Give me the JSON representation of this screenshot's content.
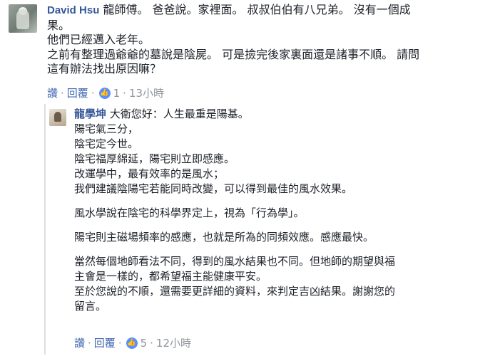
{
  "main_comment": {
    "author": "David Hsu",
    "lines": [
      "龍師傅。 爸爸說。家裡面。 叔叔伯伯有八兄弟。 沒有一個成",
      "果。",
      "他們已經邁入老年。",
      "之前有整理過爺爺的墓說是陰屍。 可是撿完後家裏面還是諸事不順。 請問",
      "這有辦法找出原因嘛？"
    ],
    "first_line_text": "龍師傅。 爸爸說。家裡面。 叔叔伯伯有八兄弟。 沒有一個成",
    "actions": {
      "like": "讚",
      "reply": "回覆",
      "like_count": "1",
      "time": "13小時"
    }
  },
  "reply_comment": {
    "author": "龍學坤",
    "first_line_text": "大衛您好：人生最重是陽基。",
    "paragraphs": [
      [
        "陽宅氣三分，",
        "陰宅定今世。",
        "陰宅福厚綿延，陽宅則立即感應。",
        "改運學中，最有效率的是風水；",
        "我們建議陰陽宅若能同時改變，可以得到最佳的風水效果。"
      ],
      [
        "風水學說在陰宅的科學界定上，視為「行為學」。"
      ],
      [
        "陽宅則主磁場頻率的感應，也就是所為的同頻效應。感應最快。"
      ],
      [
        "當然每個地師看法不同，得到的風水結果也不同。但地師的期望與福",
        "主會是一樣的，都希望福主能健康平安。",
        "至於您說的不順，還需要更詳細的資料，來判定吉凶結果。謝謝您的",
        "留言。"
      ]
    ],
    "actions": {
      "like": "讚",
      "reply": "回覆",
      "like_count": "5",
      "time": "12小時"
    }
  },
  "colors": {
    "link": "#4267b2",
    "author": "#365899",
    "meta": "#90949c",
    "like_badge": "#5890ff"
  },
  "icons": {
    "like": "thumbs-up-icon"
  }
}
